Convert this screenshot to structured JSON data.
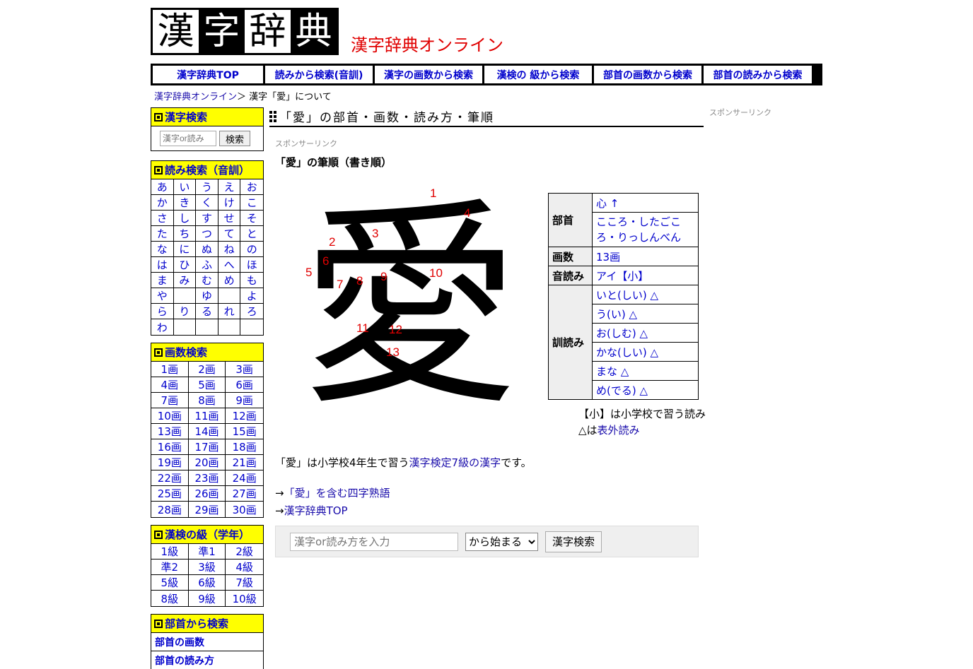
{
  "logo": {
    "chars": [
      "漢",
      "字",
      "辞",
      "典"
    ]
  },
  "site_title": "漢字辞典オンライン",
  "nav": [
    {
      "label": "漢字辞典TOP",
      "w": 158
    },
    {
      "label": "読みから検索(音訓)",
      "w": 152
    },
    {
      "label": "漢字の画数から検索",
      "w": 152
    },
    {
      "label": "漢検の 級から検索",
      "w": 152
    },
    {
      "label": "部首の画数から検索",
      "w": 152
    },
    {
      "label": "部首の読みから検索",
      "w": 152
    }
  ],
  "breadcrumb": {
    "home": "漢字辞典オンライン",
    "sep": "＞",
    "current": "漢字「愛」について"
  },
  "sidebar": {
    "search": {
      "title": "漢字検索",
      "placeholder": "漢字or読み",
      "button": "検索"
    },
    "reading": {
      "title": "読み検索（音訓）",
      "kana": [
        "あ",
        "い",
        "う",
        "え",
        "お",
        "か",
        "き",
        "く",
        "け",
        "こ",
        "さ",
        "し",
        "す",
        "せ",
        "そ",
        "た",
        "ち",
        "つ",
        "て",
        "と",
        "な",
        "に",
        "ぬ",
        "ね",
        "の",
        "は",
        "ひ",
        "ふ",
        "へ",
        "ほ",
        "ま",
        "み",
        "む",
        "め",
        "も",
        "や",
        "",
        "ゆ",
        "",
        "よ",
        "ら",
        "り",
        "る",
        "れ",
        "ろ",
        "わ",
        "",
        "",
        "",
        ""
      ]
    },
    "strokes": {
      "title": "画数検索",
      "items": [
        "1画",
        "2画",
        "3画",
        "4画",
        "5画",
        "6画",
        "7画",
        "8画",
        "9画",
        "10画",
        "11画",
        "12画",
        "13画",
        "14画",
        "15画",
        "16画",
        "17画",
        "18画",
        "19画",
        "20画",
        "21画",
        "22画",
        "23画",
        "24画",
        "25画",
        "26画",
        "27画",
        "28画",
        "29画",
        "30画"
      ]
    },
    "kanken": {
      "title": "漢検の級（学年）",
      "items": [
        "1級",
        "準1",
        "2級",
        "準2",
        "3級",
        "4級",
        "5級",
        "6級",
        "7級",
        "8級",
        "9級",
        "10級"
      ]
    },
    "bushu": {
      "title": "部首から検索",
      "items": [
        "部首の画数",
        "部首の読み方"
      ]
    }
  },
  "main": {
    "heading": "「愛」の部首・画数・読み方・筆順",
    "sponsor": "スポンサーリンク",
    "right_sponsor": "スポンサーリンク",
    "stroke_title": "「愛」の筆順（書き順）",
    "kanji": "愛",
    "stroke_numbers": [
      "1",
      "2",
      "3",
      "4",
      "5",
      "6",
      "7",
      "8",
      "9",
      "10",
      "11",
      "12",
      "13"
    ],
    "info": {
      "bushu_label": "部首",
      "bushu_value": "心 ↑",
      "bushu_reading": "こころ・したごころ・りっしんべん",
      "kakusu_label": "画数",
      "kakusu_value": "13画",
      "on_label": "音読み",
      "on_value": "アイ【小】",
      "kun_label": "訓読み",
      "kun_values": [
        "いと(しい) △",
        "う(い) △",
        "お(しむ) △",
        "かな(しい) △",
        "まな △",
        "め(でる) △"
      ]
    },
    "legend1": "【小】は小学校で習う読み",
    "legend2_prefix": "△は",
    "legend2_link": "表外読み",
    "desc_prefix": "「愛」は小学校4年生で習う",
    "desc_link": "漢字検定7級の漢字",
    "desc_suffix": "です。",
    "link1_arrow": "→",
    "link1": "「愛」を含む四字熟語",
    "link2_arrow": "→",
    "link2": "漢字辞典TOP",
    "search_placeholder": "漢字or読み方を入力",
    "search_mode": "から始まる",
    "search_button": "漢字検索"
  }
}
